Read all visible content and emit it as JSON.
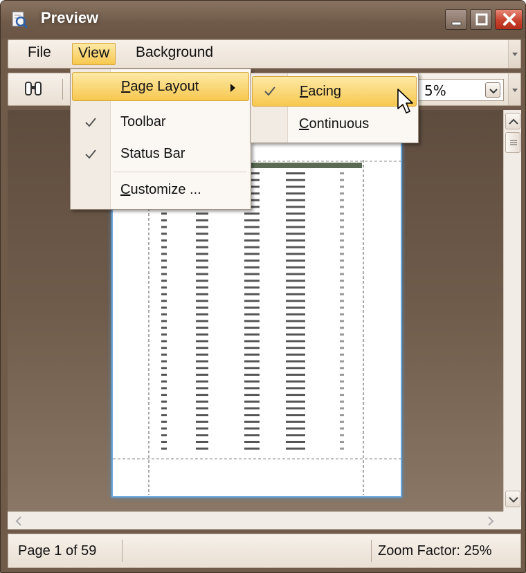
{
  "window": {
    "title": "Preview",
    "controls": [
      "minimize",
      "maximize",
      "close"
    ]
  },
  "menubar": {
    "items": [
      {
        "label": "File"
      },
      {
        "label": "View"
      },
      {
        "label": "Background"
      }
    ]
  },
  "toolbar": {
    "find_icon": "binoculars-icon",
    "zoom_value": "5%"
  },
  "view_menu": {
    "items": [
      {
        "label": "Page Layout",
        "has_submenu": true,
        "checked": false,
        "highlighted": true
      },
      {
        "label": "Toolbar",
        "checked": true
      },
      {
        "label": "Status Bar",
        "checked": true
      },
      {
        "label": "Customize ...",
        "checked": false
      }
    ]
  },
  "page_layout_submenu": {
    "items": [
      {
        "label": "Facing",
        "checked": true,
        "highlighted": true
      },
      {
        "label": "Continuous",
        "checked": false
      }
    ]
  },
  "statusbar": {
    "page_info": "Page 1 of 59",
    "zoom_info": "Zoom Factor: 25%"
  },
  "colors": {
    "frame": "#705b4a",
    "highlight": "#f7c84f",
    "page_border": "#6aa8dc"
  }
}
